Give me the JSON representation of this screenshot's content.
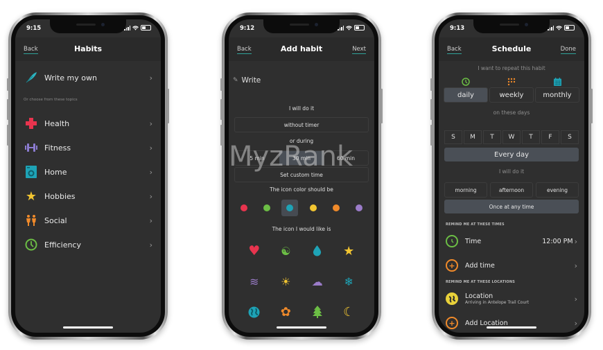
{
  "phone1": {
    "status_time": "9:15",
    "nav": {
      "back": "Back",
      "title": "Habits"
    },
    "write_own": "Write my own",
    "hint": "Or choose from these topics",
    "topics": [
      {
        "label": "Health",
        "icon": "health-cross-icon",
        "color": "#e8344e"
      },
      {
        "label": "Fitness",
        "icon": "dumbbell-icon",
        "color": "#8b7bd0"
      },
      {
        "label": "Home",
        "icon": "washing-machine-icon",
        "color": "#1ea3b6"
      },
      {
        "label": "Hobbies",
        "icon": "star-icon",
        "color": "#f2c531"
      },
      {
        "label": "Social",
        "icon": "people-icon",
        "color": "#f08a2a"
      },
      {
        "label": "Efficiency",
        "icon": "clock-icon",
        "color": "#6cbe45"
      }
    ]
  },
  "phone2": {
    "status_time": "9:12",
    "nav": {
      "back": "Back",
      "title": "Add habit",
      "next": "Next"
    },
    "write_label": "Write",
    "will_do": "I will do it",
    "without_timer": "without timer",
    "or_during": "or during",
    "durations": [
      "5 min",
      "30 min",
      "60 min"
    ],
    "selected_duration": "30 min",
    "custom_time": "Set custom time",
    "color_label": "The icon color should be",
    "colors": [
      "#e8344e",
      "#6cbe45",
      "#1ea3b6",
      "#f2c531",
      "#f08a2a",
      "#9b7cc9"
    ],
    "selected_color_index": 2,
    "icon_label": "The icon I would like is",
    "icons": [
      {
        "name": "heart-icon",
        "glyph": "♥",
        "color": "#e8344e"
      },
      {
        "name": "yin-yang-icon",
        "glyph": "☯",
        "color": "#6cbe45"
      },
      {
        "name": "water-drop-icon",
        "glyph": "💧",
        "color": "#1ea3b6"
      },
      {
        "name": "star-icon",
        "glyph": "★",
        "color": "#f2c531"
      },
      {
        "name": "wind-icon",
        "glyph": "≋",
        "color": "#9b7cc9"
      },
      {
        "name": "sun-icon",
        "glyph": "☀",
        "color": "#f2c531"
      },
      {
        "name": "storm-cloud-icon",
        "glyph": "☁",
        "color": "#9b7cc9"
      },
      {
        "name": "snowflake-icon",
        "glyph": "❄",
        "color": "#1ea3b6"
      },
      {
        "name": "globe-icon",
        "glyph": "◍",
        "color": "#1ea3b6"
      },
      {
        "name": "flower-icon",
        "glyph": "✿",
        "color": "#f08a2a"
      },
      {
        "name": "tree-icon",
        "glyph": "▲",
        "color": "#6cbe45"
      },
      {
        "name": "moon-icon",
        "glyph": "☾",
        "color": "#f2c531"
      }
    ],
    "watermark": "MyzRank"
  },
  "phone3": {
    "status_time": "9:13",
    "nav": {
      "back": "Back",
      "title": "Schedule",
      "done": "Done"
    },
    "repeat_label": "I want to repeat this habit",
    "frequencies": [
      {
        "label": "daily",
        "icon": "clock-icon",
        "color": "#6cbe45",
        "selected": true
      },
      {
        "label": "weekly",
        "icon": "grid-dots-icon",
        "color": "#f08a2a",
        "selected": false
      },
      {
        "label": "monthly",
        "icon": "calendar-icon",
        "color": "#1ea3b6",
        "selected": false
      }
    ],
    "days_label": "on these days",
    "days": [
      "S",
      "M",
      "T",
      "W",
      "T",
      "F",
      "S"
    ],
    "every_day": "Every day",
    "will_do": "I will do it",
    "times_of_day": [
      "morning",
      "afternoon",
      "evening"
    ],
    "once_any": "Once at any time",
    "remind_times_header": "REMIND ME AT THESE TIMES",
    "time_row": {
      "label": "Time",
      "value": "12:00 PM"
    },
    "add_time": "Add time",
    "remind_locations_header": "REMIND ME AT THESE LOCATIONS",
    "location_row": {
      "label": "Location",
      "sub": "Arriving in Antelope Trail Court"
    },
    "add_location": "Add Location"
  }
}
